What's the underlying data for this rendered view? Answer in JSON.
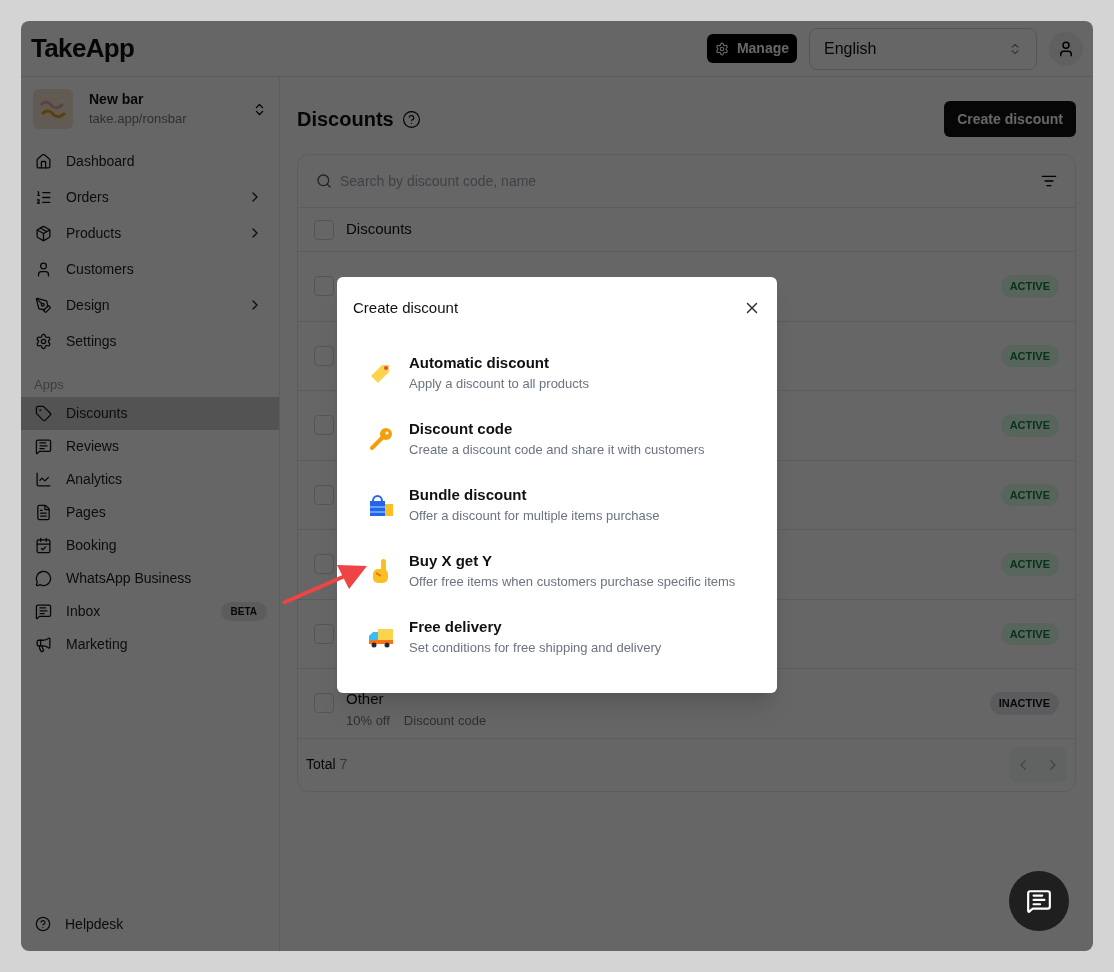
{
  "app": {
    "logo": "TakeApp",
    "manage_button": "Manage",
    "language": "English"
  },
  "store": {
    "name": "New bar",
    "url": "take.app/ronsbar"
  },
  "sidebar": {
    "items": [
      {
        "label": "Dashboard",
        "chevron": false,
        "selected": false
      },
      {
        "label": "Orders",
        "chevron": true,
        "selected": false
      },
      {
        "label": "Products",
        "chevron": true,
        "selected": false
      },
      {
        "label": "Customers",
        "chevron": false,
        "selected": false
      },
      {
        "label": "Design",
        "chevron": true,
        "selected": false
      },
      {
        "label": "Settings",
        "chevron": false,
        "selected": false
      }
    ],
    "section": "Apps",
    "apps": [
      {
        "label": "Discounts",
        "selected": true
      },
      {
        "label": "Reviews",
        "selected": false
      },
      {
        "label": "Analytics",
        "selected": false
      },
      {
        "label": "Pages",
        "selected": false
      },
      {
        "label": "Booking",
        "selected": false
      },
      {
        "label": "WhatsApp Business",
        "selected": false
      },
      {
        "label": "Inbox",
        "badge": "BETA",
        "selected": false
      },
      {
        "label": "Marketing",
        "selected": false
      }
    ],
    "footer": "Helpdesk"
  },
  "page": {
    "title": "Discounts",
    "create_button": "Create discount"
  },
  "table": {
    "search": {
      "placeholder": "Search by discount code, name"
    },
    "header": "Discounts",
    "header_checked": false,
    "rows": [
      {
        "status": "ACTIVE",
        "active": true,
        "checked": false
      },
      {
        "status": "ACTIVE",
        "active": true,
        "checked": false
      },
      {
        "status": "ACTIVE",
        "active": true,
        "checked": false
      },
      {
        "status": "ACTIVE",
        "active": true,
        "checked": false
      },
      {
        "status": "ACTIVE",
        "active": true,
        "checked": false
      },
      {
        "status": "ACTIVE",
        "active": true,
        "checked": false
      },
      {
        "name": "Other",
        "value": "10% off",
        "type": "Discount code",
        "status": "INACTIVE",
        "active": false,
        "checked": false
      }
    ],
    "total_label": "Total",
    "total": "7"
  },
  "dialog": {
    "title": "Create discount",
    "options": [
      {
        "title": "Automatic discount",
        "description": "Apply a discount to all products"
      },
      {
        "title": "Discount code",
        "description": "Create a discount code and share it with customers"
      },
      {
        "title": "Bundle discount",
        "description": "Offer a discount for multiple items purchase"
      },
      {
        "title": "Buy X get Y",
        "description": "Offer free items when customers purchase specific items"
      },
      {
        "title": "Free delivery",
        "description": "Set conditions for free shipping and delivery"
      }
    ]
  }
}
